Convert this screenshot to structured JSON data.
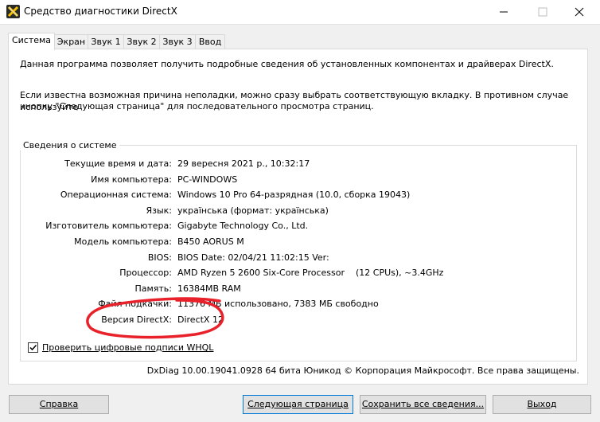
{
  "window": {
    "title": "Средство диагностики DirectX",
    "minimize_glyph": "—",
    "maximize_glyph": "☐",
    "close_glyph": "✕"
  },
  "tabs": [
    {
      "label": "Система",
      "active": true
    },
    {
      "label": "Экран"
    },
    {
      "label": "Звук 1"
    },
    {
      "label": "Звук 2"
    },
    {
      "label": "Звук 3"
    },
    {
      "label": "Ввод"
    }
  ],
  "intro": {
    "line1": "Данная программа позволяет получить подробные сведения об установленных компонентах и драйверах DirectX.",
    "line2": "Если известна возможная причина неполадки, можно сразу выбрать соответствующую вкладку. В противном случае используйте",
    "line3": "кнопку \"Следующая страница\" для последовательного просмотра страниц."
  },
  "system_info": {
    "group_title": "Сведения о системе",
    "rows": [
      {
        "label": "Текущие время и дата:",
        "value": "29 вересня 2021 р., 10:32:17"
      },
      {
        "label": "Имя компьютера:",
        "value": "PC-WINDOWS"
      },
      {
        "label": "Операционная система:",
        "value": "Windows 10 Pro 64-разрядная (10.0, сборка 19043)"
      },
      {
        "label": "Язык:",
        "value": "українська (формат: українська)"
      },
      {
        "label": "Изготовитель компьютера:",
        "value": "Gigabyte Technology Co., Ltd."
      },
      {
        "label": "Модель компьютера:",
        "value": "B450 AORUS M"
      },
      {
        "label": "BIOS:",
        "value": "BIOS Date: 02/04/21 11:02:15 Ver:"
      },
      {
        "label": "Процессор:",
        "value": "AMD Ryzen 5 2600 Six-Core Processor",
        "extra": "(12 CPUs), ~3.4GHz"
      },
      {
        "label": "Память:",
        "value": "16384MB RAM"
      },
      {
        "label": "Файл подкачки:",
        "value": "11376 МБ использовано, 7383 МБ свободно"
      },
      {
        "label": "Версия DirectX:",
        "value": "DirectX 12"
      }
    ]
  },
  "whql_checkbox": {
    "label": "Проверить цифровые подписи WHQL",
    "checked": true
  },
  "footer": "DxDiag 10.00.19041.0928 64 бита Юникод © Корпорация Майкрософт. Все права защищены.",
  "buttons": {
    "help": "Справка",
    "next": "Следующая страница",
    "save": "Сохранить все сведения...",
    "exit": "Выход"
  },
  "colors": {
    "annotation": "#e8212a",
    "accent": "#0078d7"
  }
}
